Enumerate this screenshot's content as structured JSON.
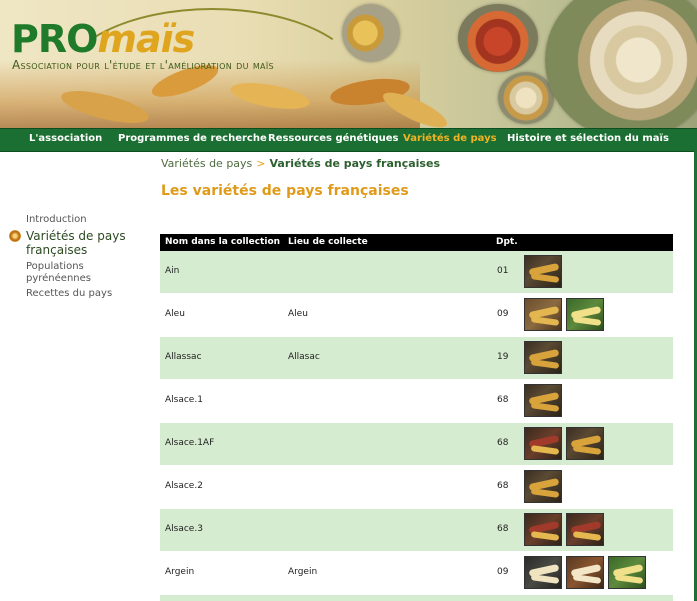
{
  "header": {
    "logo_pro": "PRO",
    "logo_mais": "maïs",
    "tagline": "Association pour l'étude et l'amélioration du maïs"
  },
  "nav": {
    "items": [
      {
        "label": "L'association"
      },
      {
        "label": "Programmes de recherche"
      },
      {
        "label": "Ressources génétiques"
      },
      {
        "label": "Variétés de pays",
        "active": true
      },
      {
        "label": "Histoire et sélection du maïs"
      }
    ]
  },
  "breadcrumb": {
    "parent": "Variétés de pays",
    "separator": ">",
    "current": "Variétés de pays françaises"
  },
  "page_title": "Les variétés de pays françaises",
  "sidebar": {
    "items": [
      {
        "label": "Introduction"
      },
      {
        "label_line1": "Variétés de pays",
        "label_line2": "françaises",
        "current": true
      },
      {
        "label_line1": "Populations",
        "label_line2": "pyrénéennes"
      },
      {
        "label": "Recettes du pays"
      }
    ]
  },
  "table": {
    "columns": [
      "Nom dans la collection",
      "Lieu de collecte",
      "Dpt."
    ],
    "rows": [
      {
        "name": "Ain",
        "lieu": "",
        "dpt": "01",
        "photos": 1
      },
      {
        "name": "Aleu",
        "lieu": "Aleu",
        "dpt": "09",
        "photos": 2
      },
      {
        "name": "Allassac",
        "lieu": "Allasac",
        "dpt": "19",
        "photos": 1
      },
      {
        "name": "Alsace.1",
        "lieu": "",
        "dpt": "68",
        "photos": 1
      },
      {
        "name": "Alsace.1AF",
        "lieu": "",
        "dpt": "68",
        "photos": 2
      },
      {
        "name": "Alsace.2",
        "lieu": "",
        "dpt": "68",
        "photos": 1
      },
      {
        "name": "Alsace.3",
        "lieu": "",
        "dpt": "68",
        "photos": 2
      },
      {
        "name": "Argein",
        "lieu": "Argein",
        "dpt": "09",
        "photos": 3
      }
    ]
  },
  "colors": {
    "nav_bg": "#1b6f32",
    "nav_active": "#f2b323",
    "title": "#e09a1a",
    "row_alt": "#d6ecd0",
    "table_head": "#000000"
  },
  "icons": {
    "sidebar_bullet": "corn-cob-bullet-icon",
    "photo": "corn-photo-thumbnail"
  }
}
